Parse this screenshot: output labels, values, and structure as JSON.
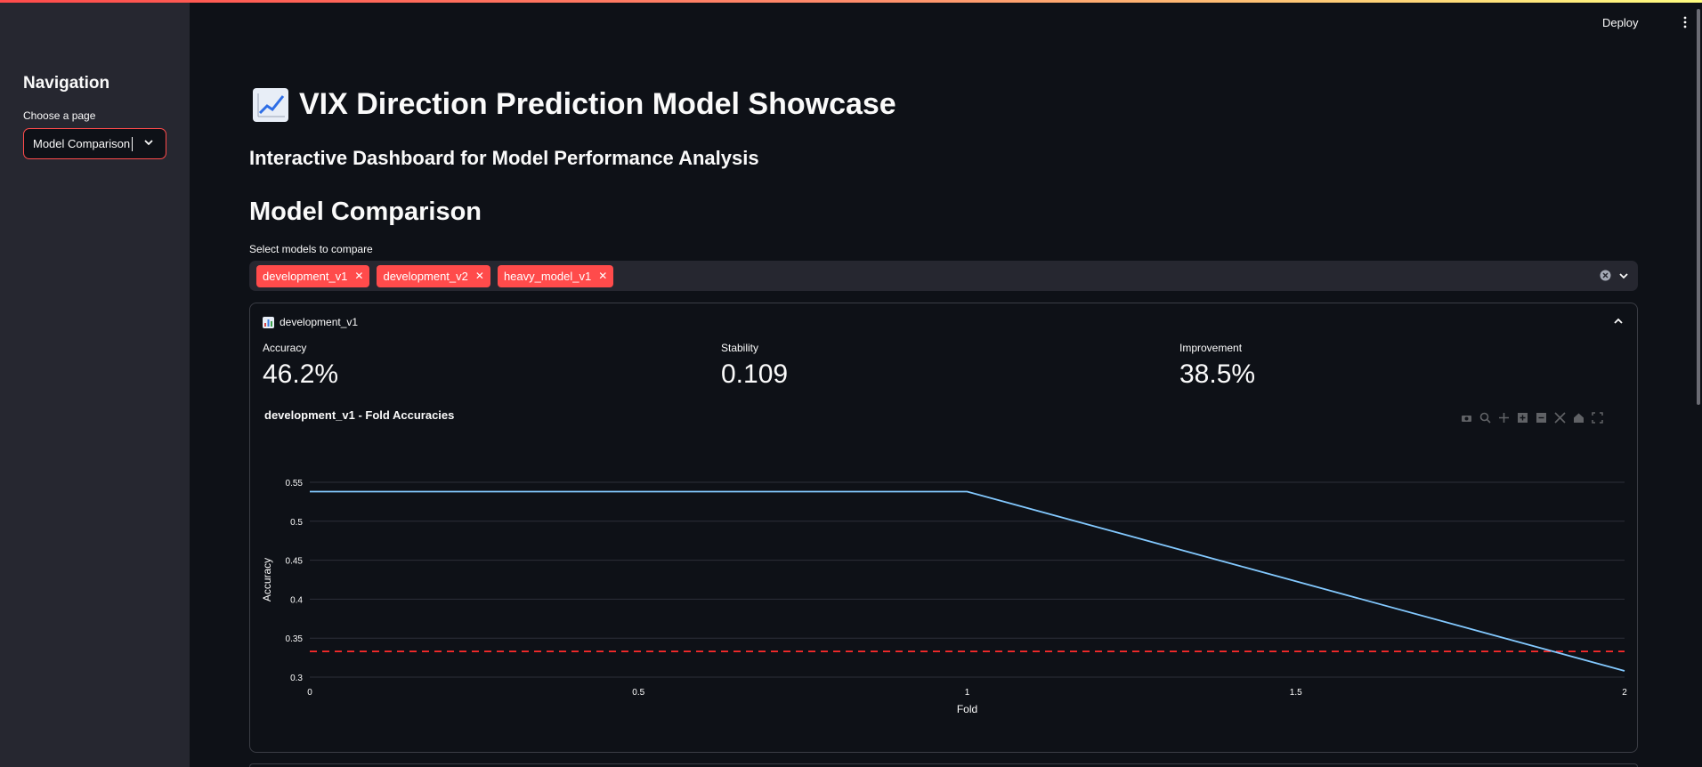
{
  "sidebar": {
    "title": "Navigation",
    "select_label": "Choose a page",
    "select_value": "Model Comparison"
  },
  "header": {
    "deploy_label": "Deploy"
  },
  "main": {
    "title": "VIX Direction Prediction Model Showcase",
    "subtitle": "Interactive Dashboard for Model Performance Analysis",
    "section_title": "Model Comparison",
    "multiselect_label": "Select models to compare",
    "selected_models": [
      "development_v1",
      "development_v2",
      "heavy_model_v1"
    ]
  },
  "expander": {
    "title": "development_v1",
    "metrics": [
      {
        "label": "Accuracy",
        "value": "46.2%"
      },
      {
        "label": "Stability",
        "value": "0.109"
      },
      {
        "label": "Improvement",
        "value": "38.5%"
      }
    ]
  },
  "colors": {
    "accent": "#ff4b4b",
    "line": "#83c9ff",
    "baseline": "#ff2b2b"
  },
  "chart_data": {
    "type": "line",
    "title": "development_v1 - Fold Accuracies",
    "xlabel": "Fold",
    "ylabel": "Accuracy",
    "x": [
      0,
      1,
      2
    ],
    "series": [
      {
        "values": [
          0.538,
          0.538,
          0.308
        ]
      }
    ],
    "baseline": 0.333,
    "xlim": [
      0,
      2
    ],
    "ylim": [
      0.3,
      0.55
    ],
    "xticks": [
      "0",
      "0.5",
      "1",
      "1.5",
      "2"
    ],
    "yticks": [
      "0.3",
      "0.35",
      "0.4",
      "0.45",
      "0.5",
      "0.55"
    ],
    "grid": true
  }
}
